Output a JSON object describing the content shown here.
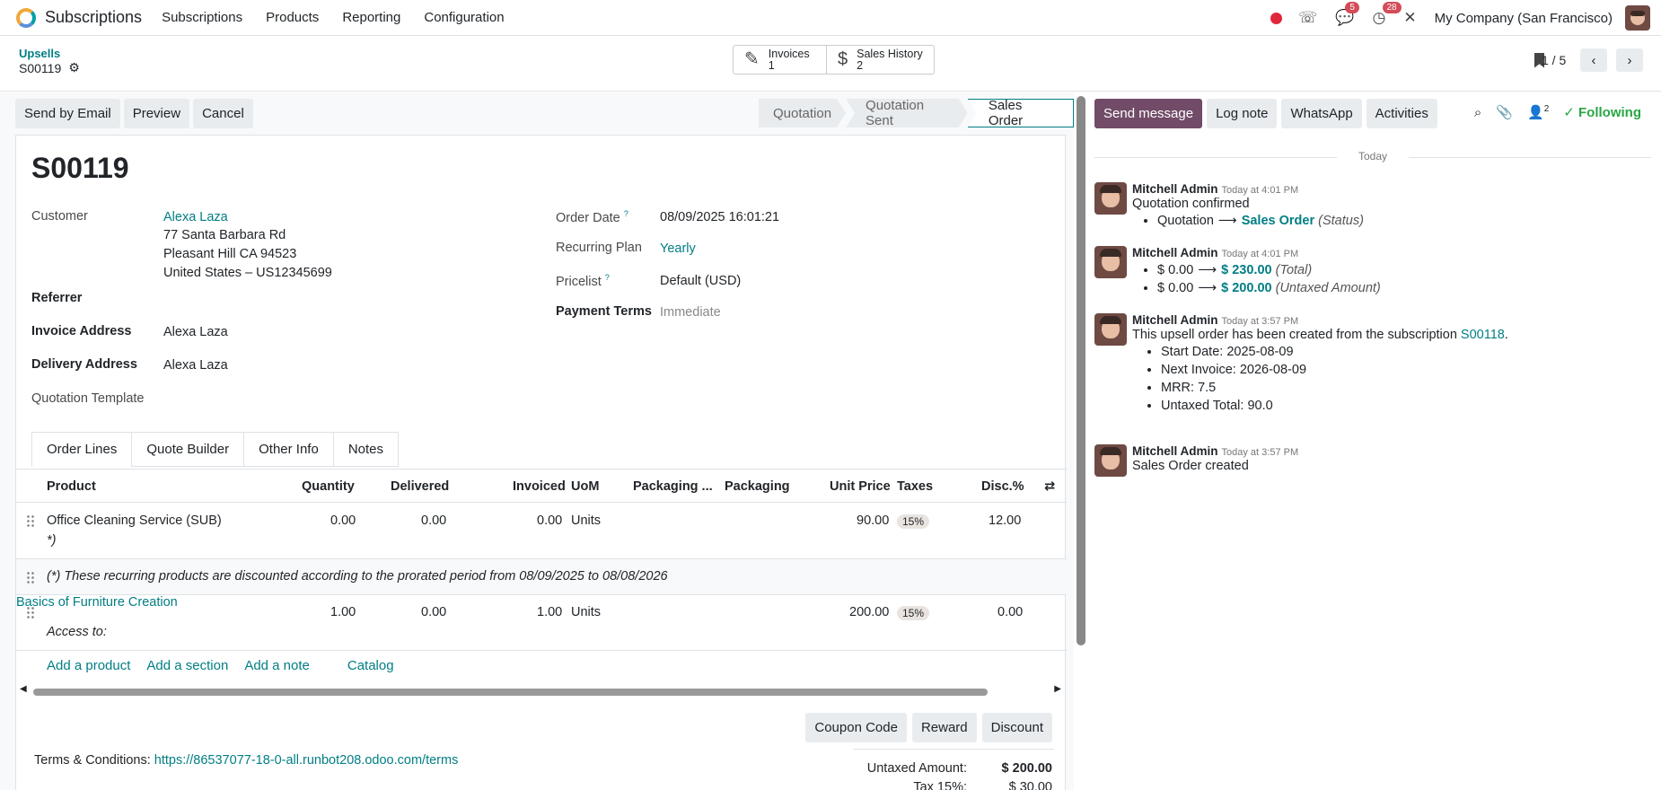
{
  "topbar": {
    "app_name": "Subscriptions",
    "menu": [
      "Subscriptions",
      "Products",
      "Reporting",
      "Configuration"
    ],
    "messages_badge": "5",
    "activities_badge": "28",
    "company": "My Company (San Francisco)"
  },
  "control_panel": {
    "breadcrumb_parent": "Upsells",
    "breadcrumb_current": "S00119",
    "smart_buttons": [
      {
        "label": "Invoices",
        "count": "1",
        "icon": "invoice-icon"
      },
      {
        "label": "Sales History",
        "count": "2",
        "icon": "dollar-icon"
      }
    ],
    "pager": "1 / 5"
  },
  "actions": {
    "send_email": "Send by Email",
    "preview": "Preview",
    "cancel": "Cancel"
  },
  "statusbar": [
    "Quotation",
    "Quotation Sent",
    "Sales Order"
  ],
  "form": {
    "name": "S00119",
    "customer_label": "Customer",
    "customer_name": "Alexa Laza",
    "address1": "77 Santa Barbara Rd",
    "address2": "Pleasant Hill CA 94523",
    "address3": "United States – US12345699",
    "referrer_label": "Referrer",
    "invoice_address_label": "Invoice Address",
    "invoice_address": "Alexa Laza",
    "delivery_address_label": "Delivery Address",
    "delivery_address": "Alexa Laza",
    "quotation_template_label": "Quotation Template",
    "order_date_label": "Order Date",
    "order_date": "08/09/2025 16:01:21",
    "recurring_plan_label": "Recurring Plan",
    "recurring_plan": "Yearly",
    "pricelist_label": "Pricelist",
    "pricelist": "Default (USD)",
    "payment_terms_label": "Payment Terms",
    "payment_terms": "Immediate",
    "help_mark": "?"
  },
  "tabs": [
    "Order Lines",
    "Quote Builder",
    "Other Info",
    "Notes"
  ],
  "lines": {
    "headers": [
      "Product",
      "Quantity",
      "Delivered",
      "Invoiced",
      "UoM",
      "Packaging ...",
      "Packaging",
      "Unit Price",
      "Taxes",
      "Disc.%"
    ],
    "rows": [
      {
        "product": "Office Cleaning Service (SUB)",
        "sub": "*)",
        "qty": "0.00",
        "delivered": "0.00",
        "invoiced": "0.00",
        "uom": "Units",
        "price": "90.00",
        "tax": "15%",
        "disc": "12.00"
      },
      {
        "product": "Basics of Furniture Creation",
        "sub": "Access to:",
        "qty": "1.00",
        "delivered": "0.00",
        "invoiced": "1.00",
        "uom": "Units",
        "price": "200.00",
        "tax": "15%",
        "disc": "0.00"
      }
    ],
    "note": "(*) These recurring products are discounted according to the prorated period from 08/09/2025 to 08/08/2026",
    "add_links": [
      "Add a product",
      "Add a section",
      "Add a note",
      "Catalog"
    ]
  },
  "bottom": {
    "coupon": "Coupon Code",
    "reward": "Reward",
    "discount": "Discount",
    "terms_label": "Terms & Conditions:",
    "terms_url": "https://86537077-18-0-all.runbot208.odoo.com/terms",
    "untaxed_label": "Untaxed Amount:",
    "untaxed_value": "$ 200.00",
    "tax_label": "Tax 15%:",
    "tax_value": "$ 30.00"
  },
  "chatter": {
    "send_message": "Send message",
    "log_note": "Log note",
    "whatsapp": "WhatsApp",
    "activities": "Activities",
    "followers_count": "2",
    "following": "Following",
    "today": "Today",
    "messages": [
      {
        "author": "Mitchell Admin",
        "time": "Today at 4:01 PM",
        "body": "Quotation confirmed",
        "old": "Quotation",
        "new": "Sales Order",
        "field": "(Status)"
      },
      {
        "author": "Mitchell Admin",
        "time": "Today at 4:01 PM",
        "old1": "$ 0.00",
        "new1": "$ 230.00",
        "field1": "(Total)",
        "old2": "$ 0.00",
        "new2": "$ 200.00",
        "field2": "(Untaxed Amount)"
      },
      {
        "author": "Mitchell Admin",
        "time": "Today at 3:57 PM",
        "body": "This upsell order has been created from the subscription",
        "link": "S00118",
        "items": [
          "Start Date: 2025-08-09",
          "Next Invoice: 2026-08-09",
          "MRR: 7.5",
          "Untaxed Total: 90.0"
        ]
      },
      {
        "author": "Mitchell Admin",
        "time": "Today at 3:57 PM",
        "body": "Sales Order created"
      }
    ]
  },
  "colors": {
    "primary": "#714b67",
    "link": "#017e84",
    "following": "#28a745",
    "badge": "#d44c59"
  }
}
